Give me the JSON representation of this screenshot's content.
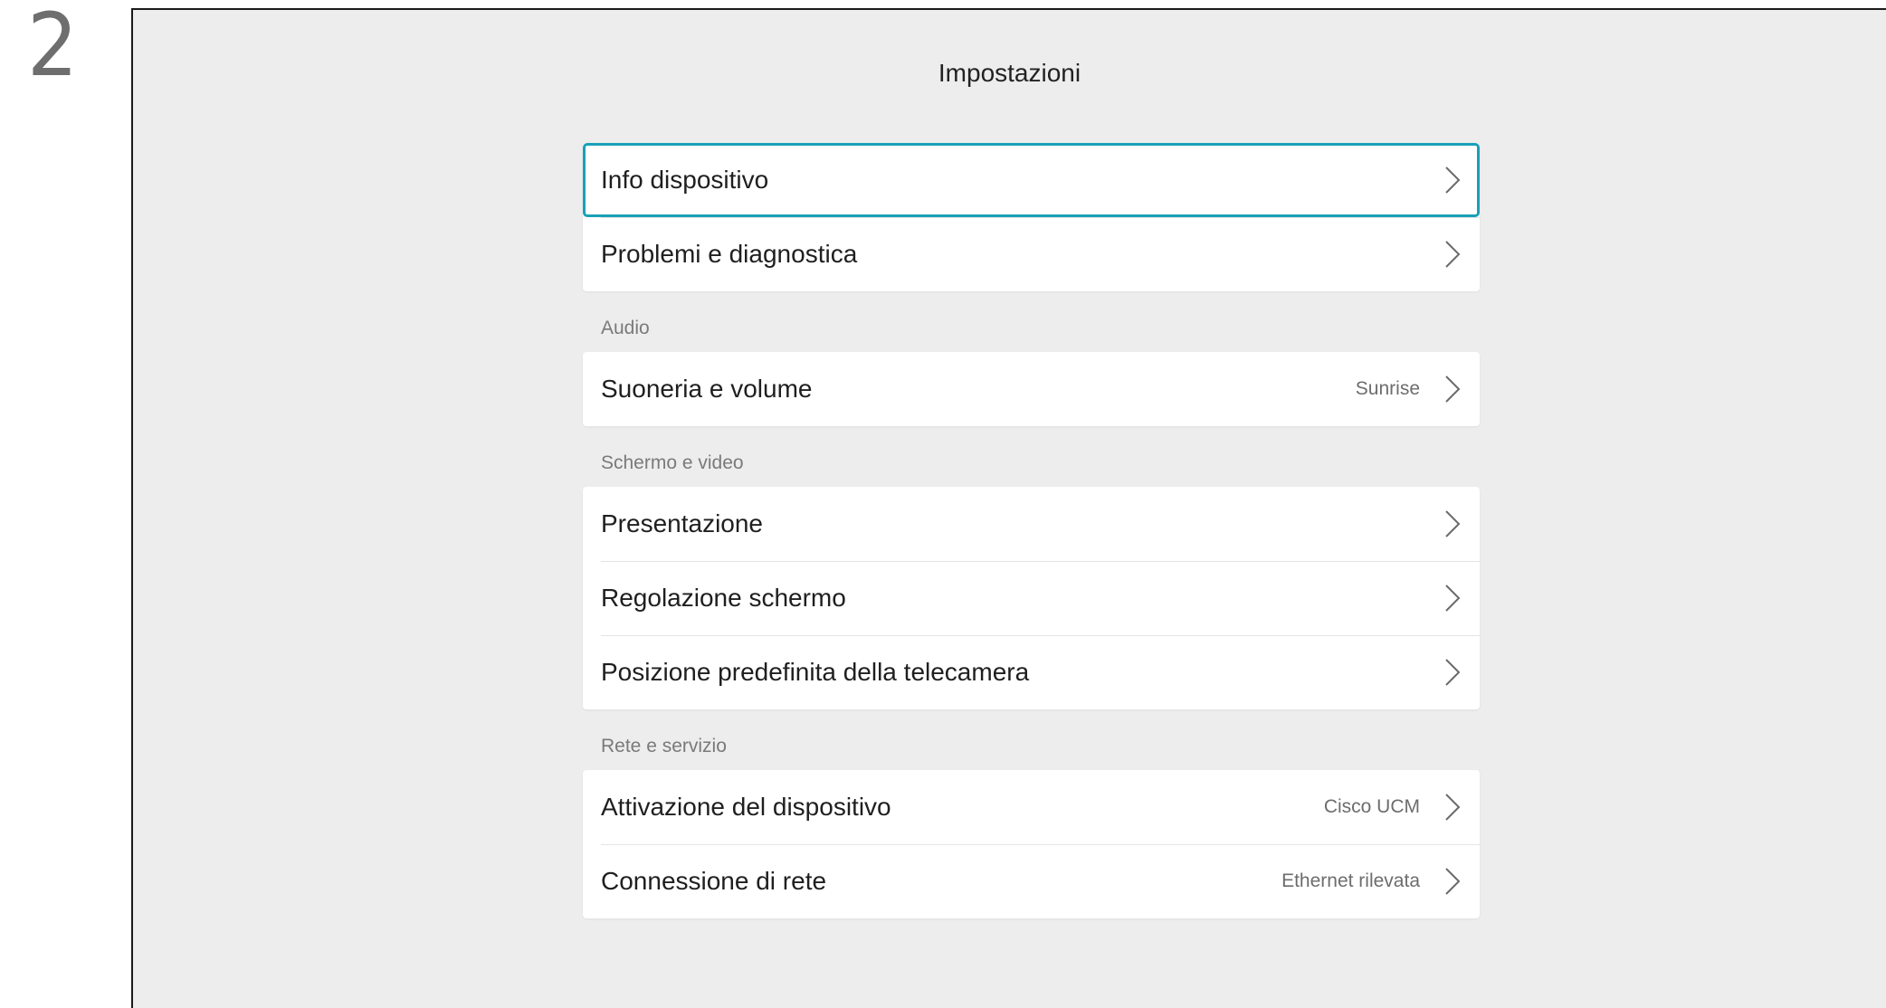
{
  "step_number": "2",
  "page": {
    "title": "Impostazioni"
  },
  "groups": [
    {
      "section_title": "",
      "items": [
        {
          "label": "Info dispositivo",
          "value": ""
        },
        {
          "label": "Problemi e diagnostica",
          "value": ""
        }
      ]
    },
    {
      "section_title": "Audio",
      "items": [
        {
          "label": "Suoneria e volume",
          "value": "Sunrise"
        }
      ]
    },
    {
      "section_title": "Schermo e video",
      "items": [
        {
          "label": "Presentazione",
          "value": ""
        },
        {
          "label": "Regolazione schermo",
          "value": ""
        },
        {
          "label": "Posizione predefinita della telecamera",
          "value": ""
        }
      ]
    },
    {
      "section_title": "Rete e servizio",
      "items": [
        {
          "label": "Attivazione del dispositivo",
          "value": "Cisco UCM"
        },
        {
          "label": "Connessione di rete",
          "value": "Ethernet rilevata"
        }
      ]
    }
  ],
  "colors": {
    "background": "#ededed",
    "focus": "#1aa0b8",
    "row": "#ffffff"
  },
  "icons": {
    "row_chevron": "chevron-right-icon"
  }
}
